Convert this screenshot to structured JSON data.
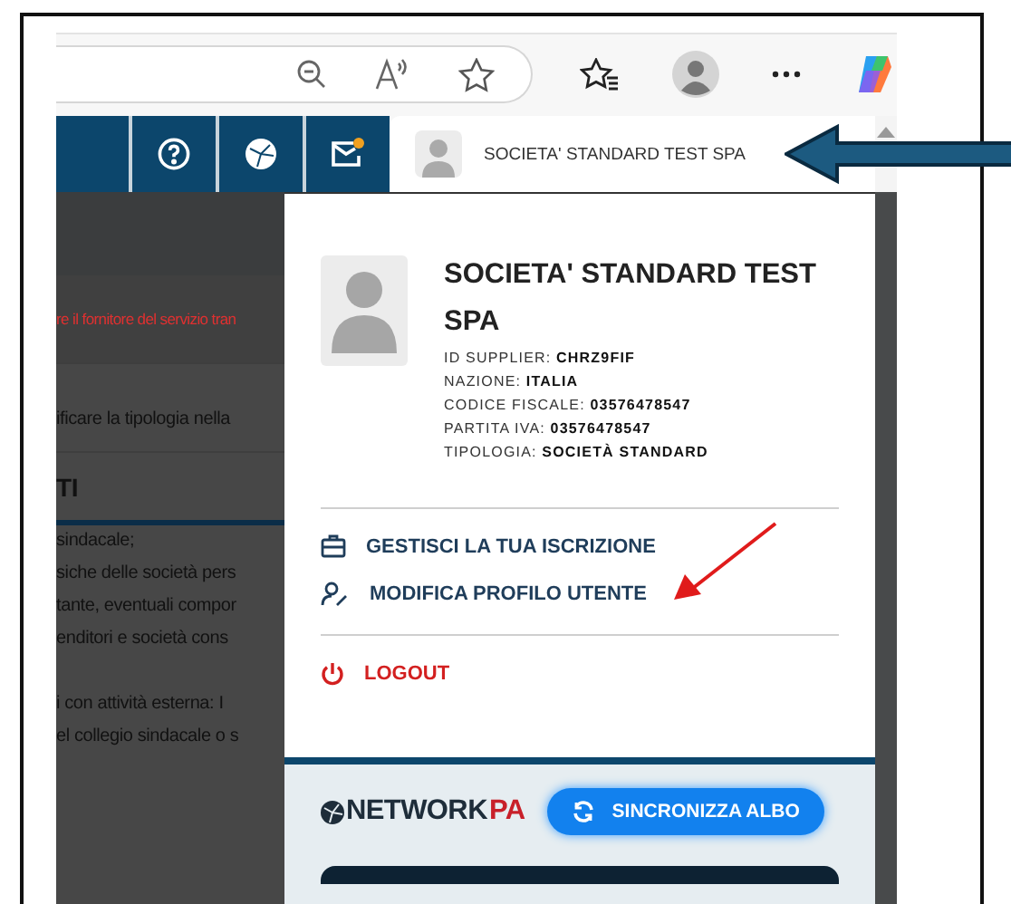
{
  "browser_toolbar": {
    "buttons": [
      {
        "kind": "zoom-out"
      },
      {
        "kind": "read-aloud"
      },
      {
        "kind": "favorite"
      },
      {
        "kind": "favorites"
      },
      {
        "kind": "profile"
      },
      {
        "kind": "more"
      },
      {
        "kind": "copilot"
      }
    ]
  },
  "nav": {
    "icons": [
      {
        "kind": "help",
        "badge": false
      },
      {
        "kind": "globe",
        "badge": false
      },
      {
        "kind": "mail",
        "badge": true
      }
    ],
    "user_tab": {
      "name": "SOCIETA' STANDARD TEST SPA"
    }
  },
  "background_page": {
    "lines": [
      {
        "kind": "notice",
        "text": "re il fornitore del servizio tran"
      },
      {
        "kind": "text",
        "text": "ificare la tipologia nella"
      },
      {
        "kind": "heading",
        "text": "TI"
      },
      {
        "kind": "text",
        "text": "sindacale;"
      },
      {
        "kind": "text",
        "text": "siche delle società pers"
      },
      {
        "kind": "text",
        "text": "tante, eventuali compor"
      },
      {
        "kind": "text",
        "text": "enditori e società cons"
      },
      {
        "kind": "gap",
        "text": "i con attività esterna: I"
      },
      {
        "kind": "text",
        "text": "el collegio sindacale o s"
      }
    ]
  },
  "profile_menu": {
    "title": "SOCIETA' STANDARD TEST SPA",
    "details": [
      "ID SUPPLIER: **CHRZ9FIF**",
      "NAZIONE: **ITALIA**",
      "CODICE FISCALE: **03576478547**",
      "PARTITA IVA: **03576478547**",
      "TIPOLOGIA: **SOCIETÀ STANDARD**"
    ],
    "items": [
      {
        "kind": "subscription",
        "label": "GESTISCI LA TUA ISCRIZIONE"
      },
      {
        "kind": "profile",
        "label": "MODIFICA PROFILO UTENTE"
      },
      {
        "kind": "logout",
        "label": "LOGOUT"
      }
    ],
    "footer": {
      "logo": [
        "NETWORK",
        "PA"
      ],
      "button": "SINCRONIZZA ALBO"
    }
  }
}
